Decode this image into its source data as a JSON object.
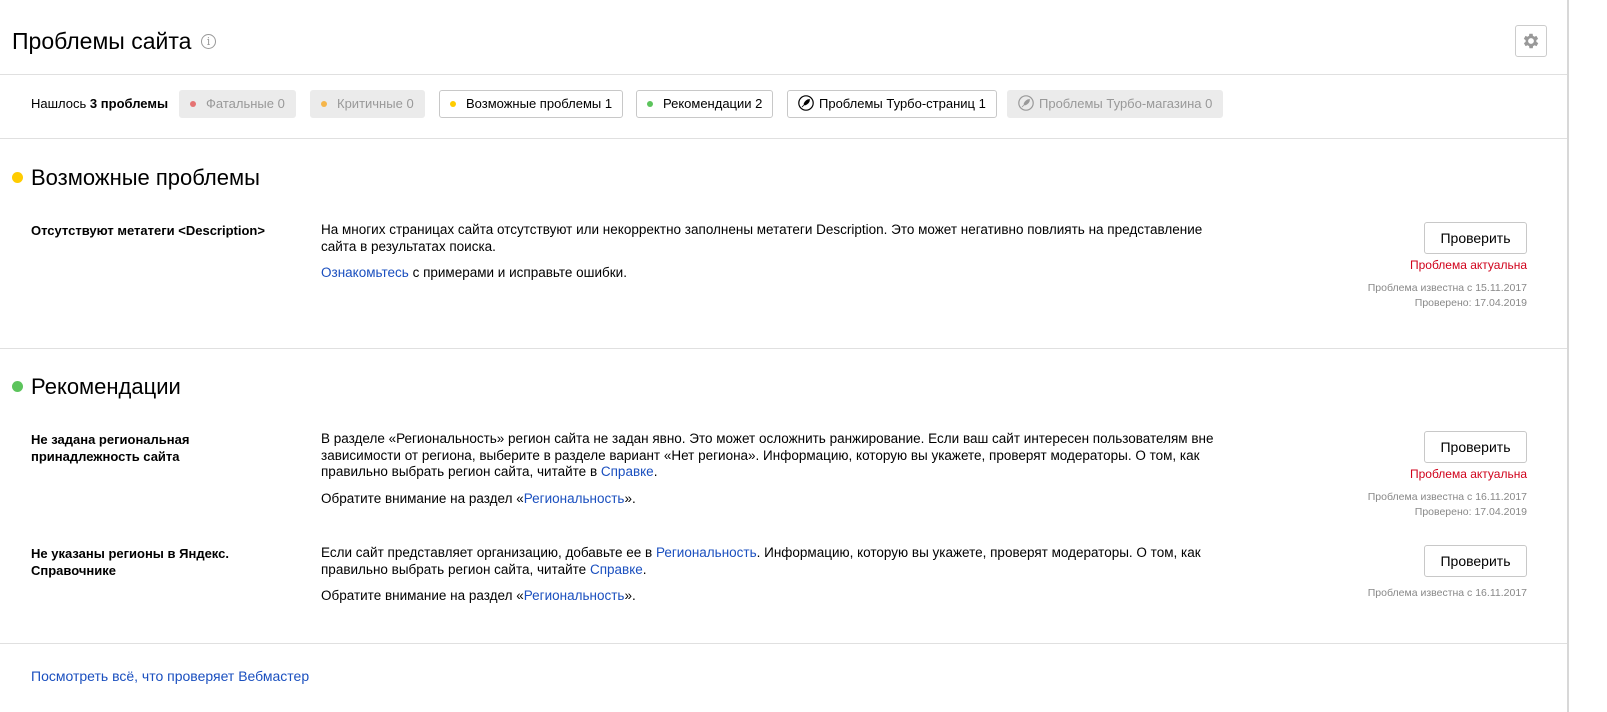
{
  "header": {
    "title": "Проблемы сайта",
    "info_icon": "info-icon",
    "settings_icon": "gear-icon"
  },
  "filters": {
    "found_prefix": "Нашлось",
    "found_count": "3",
    "found_suffix": "проблемы",
    "chips": [
      {
        "label": "Фатальные",
        "count": "0",
        "color": "#e57373",
        "state": "disabled"
      },
      {
        "label": "Критичные",
        "count": "0",
        "color": "#f5b54a",
        "state": "disabled"
      },
      {
        "label": "Возможные проблемы",
        "count": "1",
        "color": "#ffcc00",
        "state": "active"
      },
      {
        "label": "Рекомендации",
        "count": "2",
        "color": "#5cc45c",
        "state": "active"
      },
      {
        "label": "Проблемы Турбо-страниц",
        "count": "1",
        "icon": "rocket-icon",
        "state": "active"
      },
      {
        "label": "Проблемы Турбо-магазина",
        "count": "0",
        "icon": "rocket-icon",
        "state": "disabled"
      }
    ]
  },
  "sections": [
    {
      "title": "Возможные проблемы",
      "dot_color": "#ffcc00",
      "issues": [
        {
          "name": "Отсутствуют метатеги <Description>",
          "desc_1": "На многих страницах сайта отсутствуют или некорректно заполнены метатеги Description. Это может негативно повлиять на представление сайта в результатах поиска.",
          "desc_2_link": "Ознакомьтесь",
          "desc_2_text": " с примерами и исправьте ошибки.",
          "button": "Проверить",
          "status": "Проблема актуальна",
          "known": "Проблема известна с 15.11.2017",
          "checked": "Проверено: 17.04.2019"
        }
      ]
    },
    {
      "title": "Рекомендации",
      "dot_color": "#5cc45c",
      "issues": [
        {
          "name": "Не задана региональная принадлежность сайта",
          "desc_1": "В разделе «Региональность» регион сайта не задан явно. Это может осложнить ранжирование. Если ваш сайт интересен пользователям вне зависимости от региона, выберите в разделе вариант «Нет региона». Информацию, которую вы укажете, проверят модераторы. О том, как правильно выбрать регион сайта, читайте в ",
          "desc_1_link": "Справке",
          "desc_1_end": ".",
          "desc_2_text": "Обратите внимание на раздел «",
          "desc_2_link": "Региональность",
          "desc_2_end": "».",
          "button": "Проверить",
          "status": "Проблема актуальна",
          "known": "Проблема известна с 16.11.2017",
          "checked": "Проверено: 17.04.2019"
        },
        {
          "name": "Не указаны регионы в Яндекс. Справочнике",
          "desc_1": "Если сайт представляет организацию, добавьте ее в ",
          "desc_1_link": "Региональность",
          "desc_1_mid": ". Информацию, которую вы укажете, проверят модераторы. О том, как правильно выбрать регион сайта, читайте ",
          "desc_1_link2": "Справке",
          "desc_1_end": ".",
          "desc_2_text": "Обратите внимание на раздел «",
          "desc_2_link": "Региональность",
          "desc_2_end": "».",
          "button": "Проверить",
          "known": "Проблема известна с 16.11.2017"
        }
      ]
    }
  ],
  "footer": {
    "link": "Посмотреть всё, что проверяет Вебмастер"
  }
}
